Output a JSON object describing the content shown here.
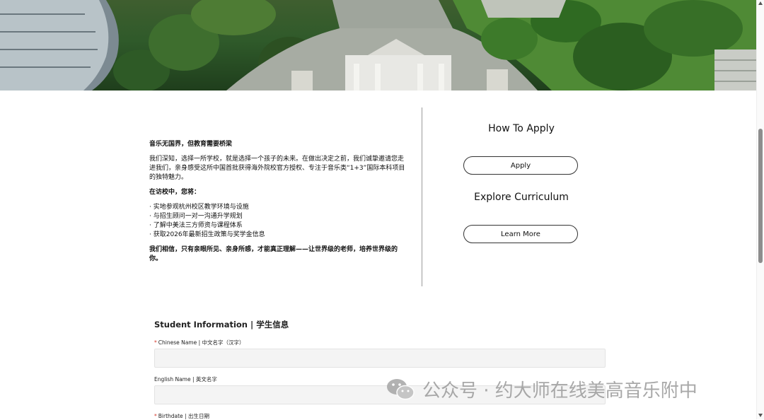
{
  "intro": {
    "heading": "音乐无国界，但教育需要桥梁",
    "para1": "我们深知，选择一所学校，就是选择一个孩子的未来。在做出决定之前，我们诚挚邀请您走进我们，亲身感受这所中国首批获得海外院校官方授权、专注于音乐类“1+3”国际本科项目的独特魅力。",
    "visit_heading": "在访校中，您将：",
    "bullets": [
      "· 实地参观杭州校区教学环境与设施",
      "· 与招生顾问一对一沟通升学规划",
      "· 了解中美法三方师资与课程体系",
      "· 获取2026年最新招生政策与奖学金信息"
    ],
    "closing": "我们相信，只有亲眼所见、亲身所感，才能真正理解——让世界级的老师，培养世界级的你。"
  },
  "cta": {
    "apply_title": "How To Apply",
    "apply_button": "Apply",
    "curriculum_title": "Explore Curriculum",
    "curriculum_button": "Learn More"
  },
  "form": {
    "title": "Student Information | 学生信息",
    "required_mark": "*",
    "fields": [
      {
        "label": "Chinese Name | 中文名字（汉字）",
        "required": true,
        "value": ""
      },
      {
        "label": "English Name | 英文名字",
        "required": false,
        "value": ""
      },
      {
        "label": "Birthdate | 出生日期",
        "required": true,
        "value": ""
      }
    ]
  },
  "watermark": {
    "text": "公众号 · 约大师在线美高音乐附中",
    "icon": "wechat-icon"
  },
  "colors": {
    "required": "#d43a2c",
    "input_bg": "#f4f4f4",
    "divider": "#9a9a9a"
  }
}
